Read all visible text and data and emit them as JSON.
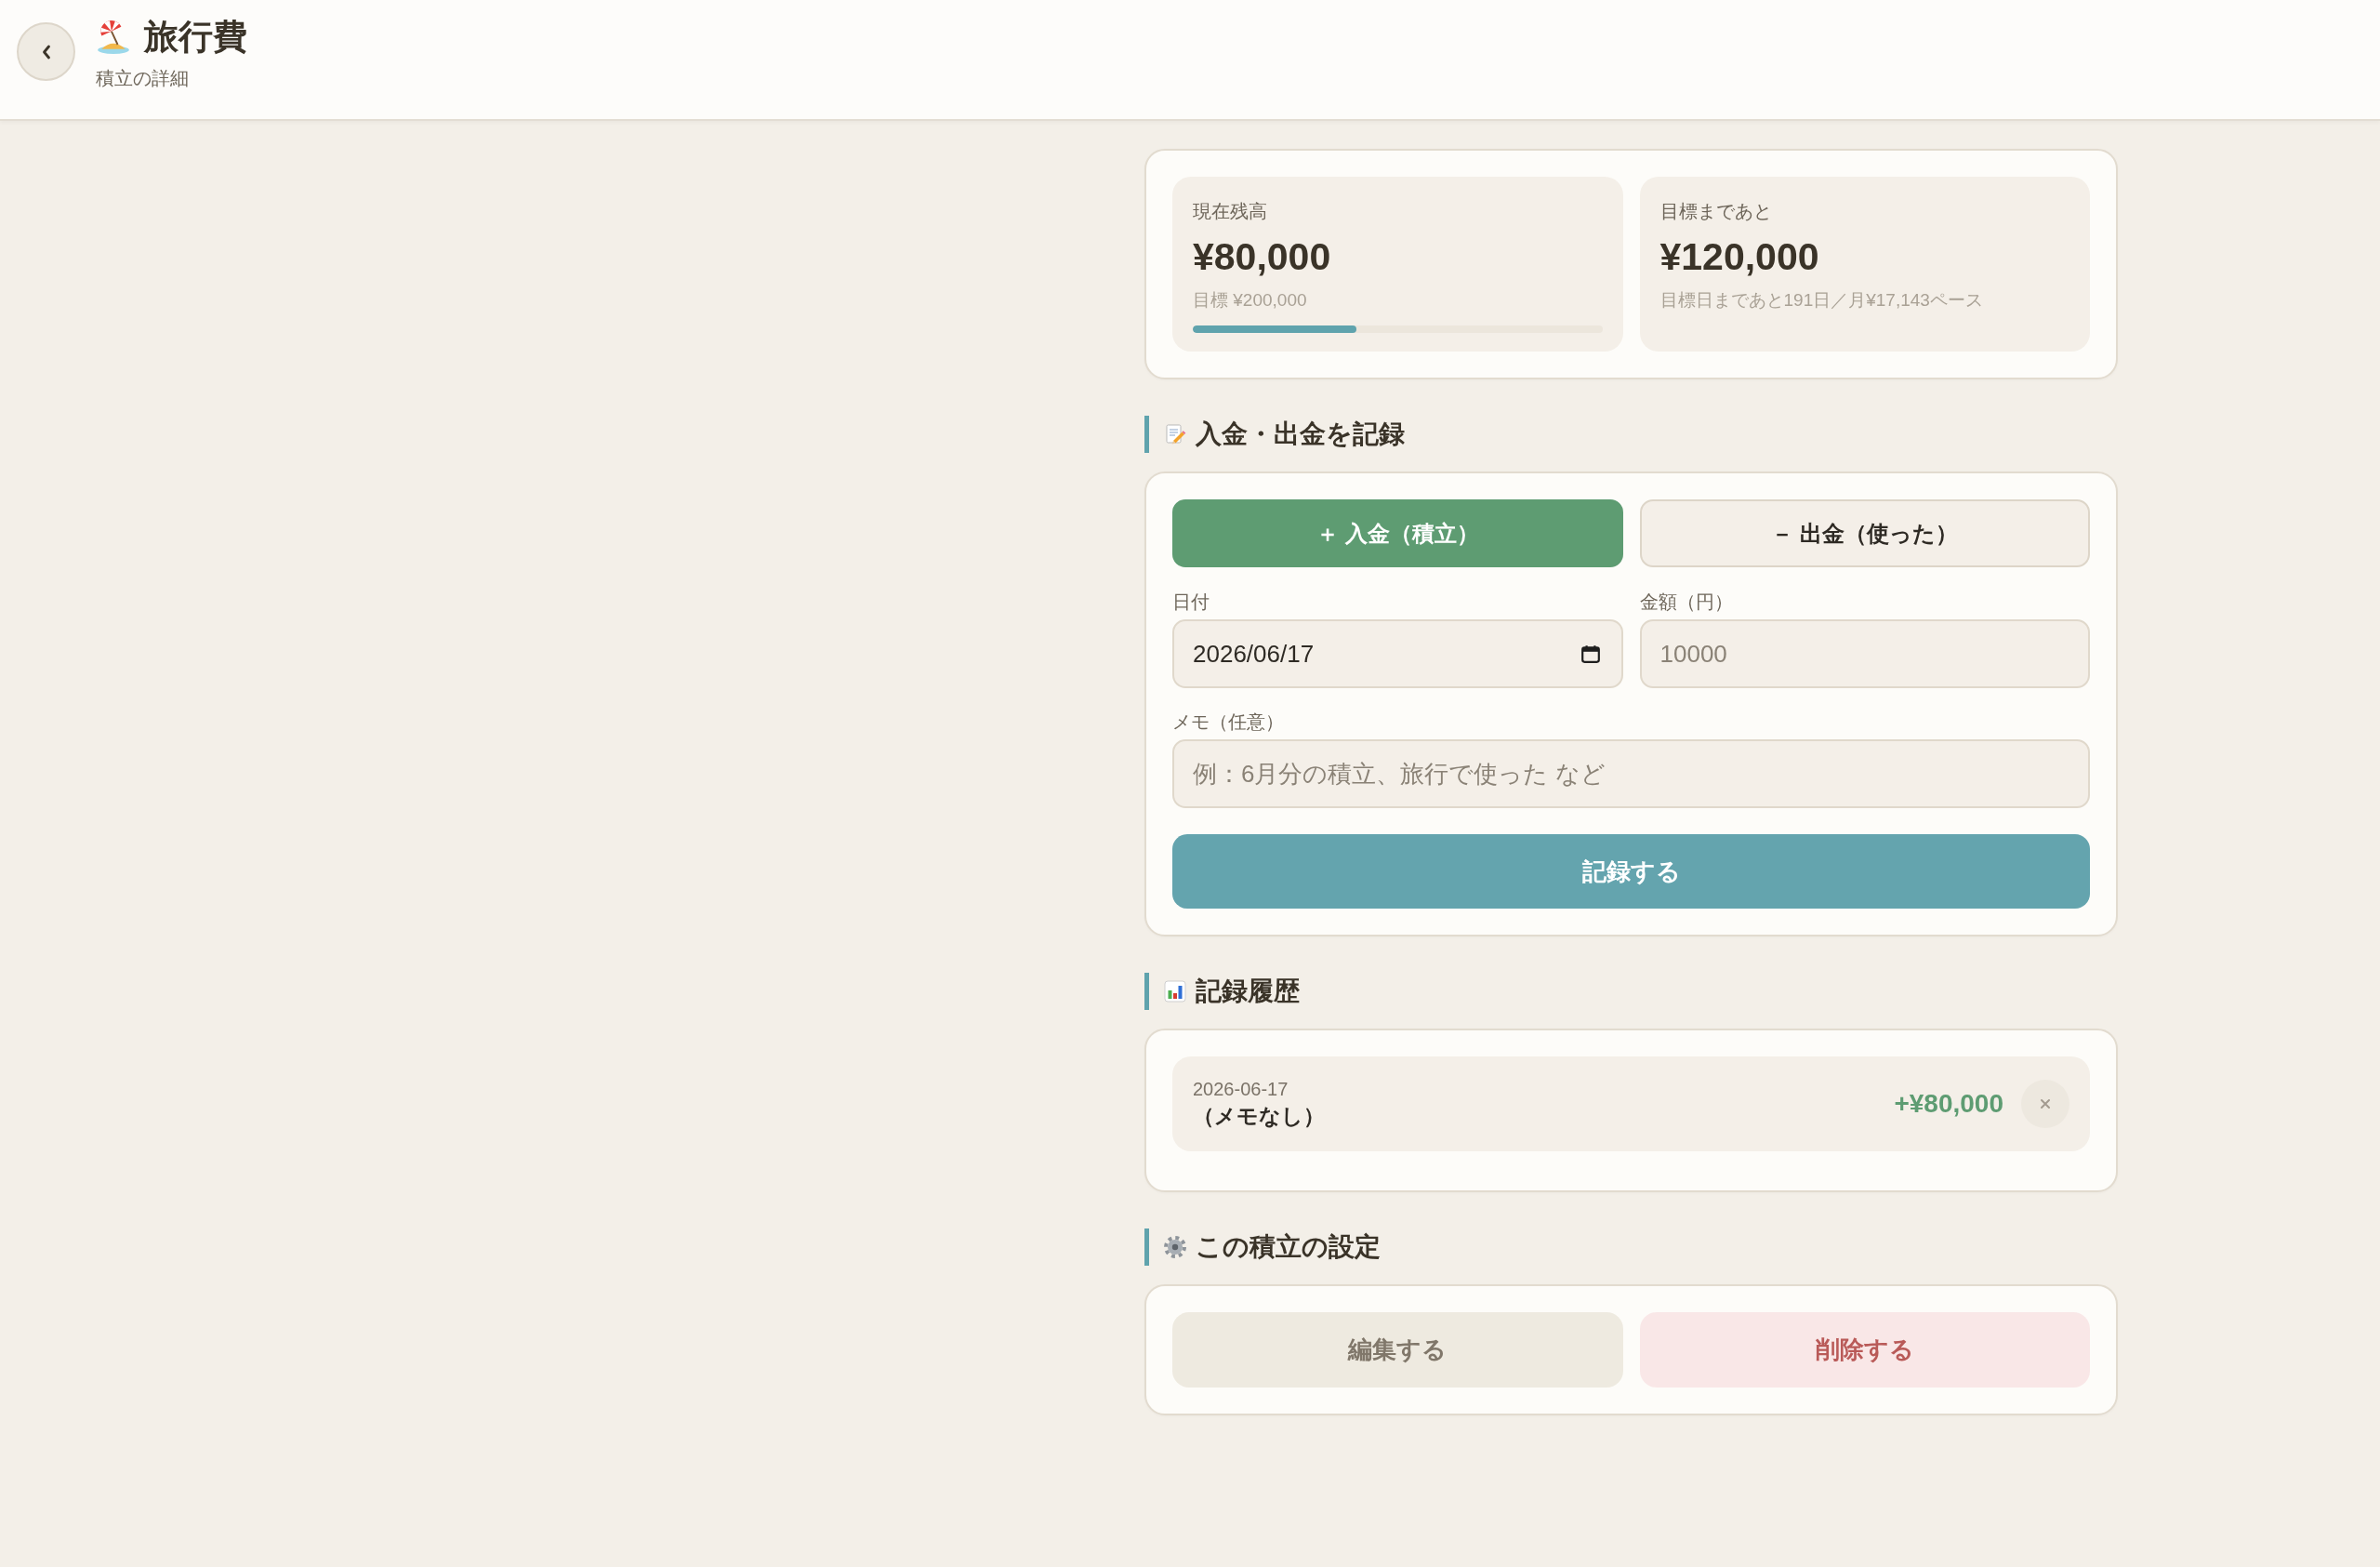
{
  "header": {
    "title": "旅行費",
    "subtitle": "積立の詳細"
  },
  "summary": [
    {
      "kind": "progress",
      "label": "現在残高",
      "amount": "¥80,000",
      "note": "目標 ¥200,000",
      "level": 0.4
    },
    {
      "kind": "plain",
      "label": "目標まであと",
      "amount": "¥120,000",
      "note": "目標日まであと191日／月¥17,143ペース"
    }
  ],
  "record": {
    "heading": "入金・出金を記録",
    "type_buttons": [
      {
        "kind": "deposit",
        "label": "＋ 入金（積立）",
        "selected": true
      },
      {
        "kind": "withdraw",
        "label": "－ 出金（使った）",
        "selected": false
      }
    ],
    "fields": [
      {
        "kind": "date",
        "label": "日付",
        "value": "2026/06/17"
      },
      {
        "kind": "number",
        "label": "金額（円）",
        "placeholder": "10000"
      },
      {
        "kind": "text",
        "label": "メモ（任意）",
        "placeholder": "例：6月分の積立、旅行で使った など"
      }
    ],
    "submit": "記録する"
  },
  "history": {
    "heading": "記録履歴",
    "entries": [
      {
        "kind": "deposit",
        "date": "2026-06-17",
        "memo": "（メモなし）",
        "amount": "+¥80,000"
      }
    ]
  },
  "settings": {
    "heading": "この積立の設定",
    "buttons": [
      {
        "kind": "edit",
        "label": "編集する"
      },
      {
        "kind": "delete",
        "label": "削除する"
      }
    ]
  }
}
